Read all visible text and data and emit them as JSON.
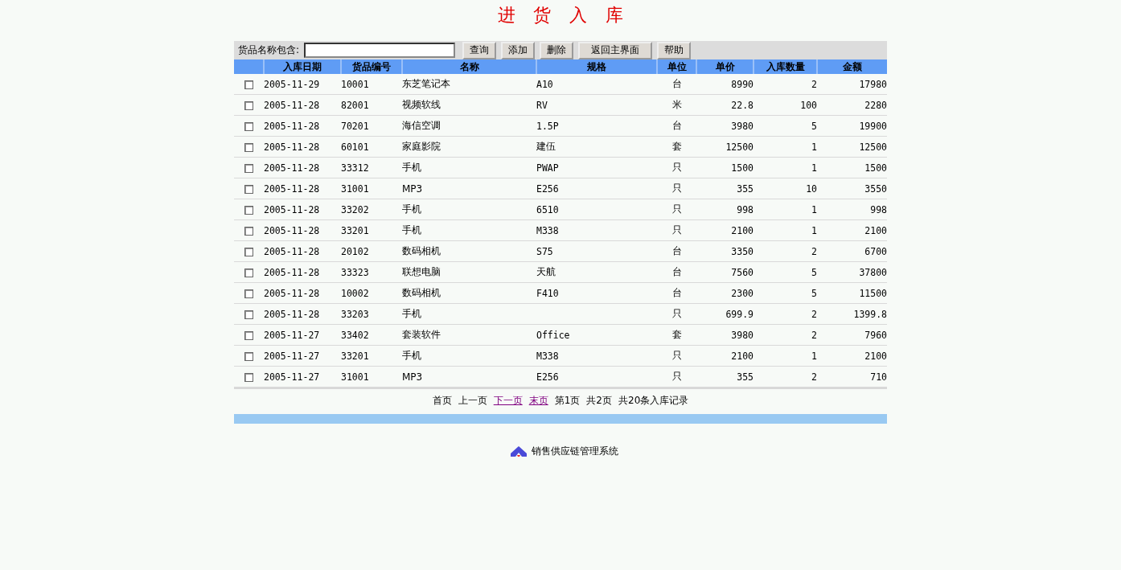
{
  "page_title": "进 货 入 库",
  "toolbar": {
    "search_label": "货品名称包含:",
    "buttons": [
      "查询",
      "添加",
      "删除",
      "返回主界面",
      "帮助"
    ]
  },
  "table": {
    "columns": [
      "入库日期",
      "货品编号",
      "名称",
      "规格",
      "单位",
      "单价",
      "入库数量",
      "金额"
    ],
    "rows": [
      {
        "checked": false,
        "cells": [
          "2005-11-29",
          "10001",
          "东芝笔记本",
          "A10",
          "台",
          "8990",
          "2",
          "17980"
        ]
      },
      {
        "checked": false,
        "cells": [
          "2005-11-28",
          "82001",
          "视频软线",
          "RV",
          "米",
          "22.8",
          "100",
          "2280"
        ]
      },
      {
        "checked": false,
        "cells": [
          "2005-11-28",
          "70201",
          "海信空调",
          "1.5P",
          "台",
          "3980",
          "5",
          "19900"
        ]
      },
      {
        "checked": false,
        "cells": [
          "2005-11-28",
          "60101",
          "家庭影院",
          "建伍",
          "套",
          "12500",
          "1",
          "12500"
        ]
      },
      {
        "checked": false,
        "cells": [
          "2005-11-28",
          "33312",
          "手机",
          "PWAP",
          "只",
          "1500",
          "1",
          "1500"
        ]
      },
      {
        "checked": false,
        "cells": [
          "2005-11-28",
          "31001",
          "MP3",
          "E256",
          "只",
          "355",
          "10",
          "3550"
        ]
      },
      {
        "checked": false,
        "cells": [
          "2005-11-28",
          "33202",
          "手机",
          "6510",
          "只",
          "998",
          "1",
          "998"
        ]
      },
      {
        "checked": false,
        "cells": [
          "2005-11-28",
          "33201",
          "手机",
          "M338",
          "只",
          "2100",
          "1",
          "2100"
        ]
      },
      {
        "checked": false,
        "cells": [
          "2005-11-28",
          "20102",
          "数码相机",
          "S75",
          "台",
          "3350",
          "2",
          "6700"
        ]
      },
      {
        "checked": false,
        "cells": [
          "2005-11-28",
          "33323",
          "联想电脑",
          "天航",
          "台",
          "7560",
          "5",
          "37800"
        ]
      },
      {
        "checked": false,
        "cells": [
          "2005-11-28",
          "10002",
          "数码相机",
          "F410",
          "台",
          "2300",
          "5",
          "11500"
        ]
      },
      {
        "checked": false,
        "cells": [
          "2005-11-28",
          "33203",
          "手机",
          "",
          "只",
          "699.9",
          "2",
          "1399.8"
        ]
      },
      {
        "checked": false,
        "cells": [
          "2005-11-27",
          "33402",
          "套装软件",
          "Office",
          "套",
          "3980",
          "2",
          "7960"
        ]
      },
      {
        "checked": false,
        "cells": [
          "2005-11-27",
          "33201",
          "手机",
          "M338",
          "只",
          "2100",
          "1",
          "2100"
        ]
      },
      {
        "checked": false,
        "cells": [
          "2005-11-27",
          "31001",
          "MP3",
          "E256",
          "只",
          "355",
          "2",
          "710"
        ]
      }
    ]
  },
  "pagination": [
    {
      "kind": "text",
      "label": "首页"
    },
    {
      "kind": "text",
      "label": "上一页"
    },
    {
      "kind": "link",
      "label": "下一页"
    },
    {
      "kind": "link",
      "label": "末页"
    },
    {
      "kind": "text",
      "label": "第1页"
    },
    {
      "kind": "text",
      "label": "共2页"
    },
    {
      "kind": "text",
      "label": "共20条入库记录"
    }
  ],
  "footer": {
    "text": "销售供应链管理系统"
  }
}
